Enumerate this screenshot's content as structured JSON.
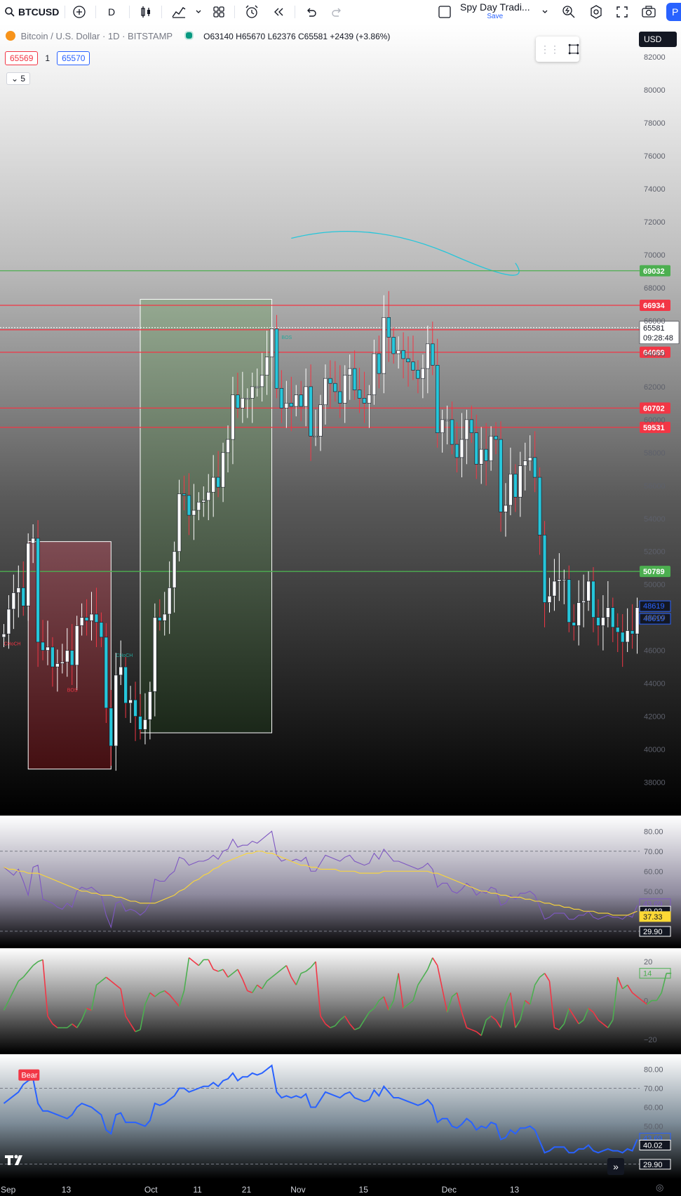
{
  "toolbar": {
    "symbol": "BTCUSD",
    "interval": "D",
    "layout_name": "Spy Day Tradi...",
    "save_label": "Save",
    "publish_label": "P"
  },
  "legend": {
    "title": "Bitcoin / U.S. Dollar · 1D · BITSTAMP",
    "open_label": "O",
    "open": "63140",
    "high_label": "H",
    "high": "65670",
    "low_label": "L",
    "low": "62376",
    "close_label": "C",
    "close": "65581",
    "change": "+2439 (+3.86%)",
    "bid": "65569",
    "spread": "1",
    "ask": "65570",
    "indicators_toggle": "5"
  },
  "currency": "USD",
  "colors": {
    "up": "#ffffff",
    "down": "#26c6da",
    "support_line": "#4caf50",
    "resistance_line": "#f23645",
    "rsi": "#7e57c2",
    "rsi_ma": "#fdd835",
    "macd_up": "#4caf50",
    "macd_down": "#f23645",
    "bottom_osc": "#2962ff",
    "arc": "#26c6da"
  },
  "icons": [
    "search-icon",
    "plus-circle-icon",
    "candles-icon",
    "indicators-icon",
    "chevron-down-icon",
    "layouts-icon",
    "alarm-icon",
    "replay-icon",
    "undo-icon",
    "redo-icon",
    "layout-box-icon",
    "lightning-icon",
    "settings-icon",
    "fullscreen-icon",
    "camera-icon",
    "drag-handle-icon",
    "rectangle-icon",
    "tradingview-logo-icon",
    "scroll-forward-icon",
    "gear-icon"
  ],
  "chart_data": [
    {
      "type": "candlestick",
      "name": "BTCUSD 1D",
      "ylim": [
        37000,
        83500
      ],
      "y_ticks": [
        38000,
        40000,
        42000,
        44000,
        46000,
        48000,
        50000,
        52000,
        54000,
        56000,
        58000,
        60000,
        62000,
        64000,
        66000,
        68000,
        70000,
        72000,
        74000,
        76000,
        78000,
        80000,
        82000
      ],
      "x_ticks": [
        "Sep",
        "13",
        "Oct",
        "11",
        "21",
        "Nov",
        "15",
        "Dec",
        "13"
      ],
      "closes": [
        47000,
        48500,
        49500,
        49800,
        48700,
        52500,
        52800,
        46500,
        46000,
        46200,
        45000,
        45200,
        45300,
        46000,
        45100,
        47500,
        48000,
        47800,
        48200,
        47700,
        46800,
        42500,
        40200,
        44500,
        45000,
        42800,
        43000,
        42000,
        41200,
        41800,
        43500,
        48000,
        47800,
        48200,
        49800,
        52000,
        55500,
        55400,
        54200,
        54500,
        55000,
        55100,
        55600,
        56500,
        55900,
        58000,
        58800,
        61500,
        60700,
        61300,
        61300,
        62000,
        62000,
        62700,
        63800,
        65500,
        61900,
        60700,
        61000,
        60800,
        61500,
        60800,
        62000,
        59000,
        59000,
        60900,
        62500,
        62200,
        61700,
        61000,
        62700,
        63100,
        61800,
        61300,
        61000,
        61500,
        64000,
        62800,
        66200,
        65000,
        64000,
        64200,
        63700,
        63500,
        63000,
        62500,
        63100,
        64600,
        63300,
        59200,
        60000,
        60000,
        58500,
        57700,
        58800,
        60000,
        59200,
        57300,
        58200,
        57500,
        59000,
        58800,
        54400,
        54800,
        56700,
        55300,
        57200,
        57500,
        57700,
        56500,
        53000,
        48900,
        49300,
        50200,
        50300,
        50300,
        47700,
        47500,
        48900,
        49000,
        50200,
        48000,
        47500,
        48000,
        48600,
        47400,
        47100,
        46500,
        47200,
        47000,
        48600
      ],
      "opens": [
        46800,
        47000,
        48500,
        49500,
        49800,
        48700,
        52500,
        52800,
        46500,
        46000,
        46200,
        45000,
        45200,
        45300,
        46000,
        45100,
        47500,
        48000,
        47800,
        48200,
        47700,
        46800,
        42500,
        40200,
        44500,
        45000,
        42800,
        43000,
        42000,
        41200,
        41800,
        43500,
        48000,
        47800,
        48200,
        49800,
        52000,
        55500,
        55400,
        54200,
        54500,
        55000,
        55100,
        55600,
        56500,
        55900,
        58000,
        58800,
        61500,
        60700,
        61300,
        61300,
        62000,
        62000,
        62700,
        63800,
        65500,
        61900,
        60700,
        61000,
        60800,
        61500,
        60800,
        62000,
        59000,
        59000,
        60900,
        62500,
        62200,
        61700,
        61000,
        62700,
        63100,
        61800,
        61300,
        61000,
        61500,
        64000,
        62800,
        66200,
        65000,
        64000,
        64200,
        63700,
        63500,
        63000,
        62500,
        63100,
        64600,
        63300,
        59200,
        60000,
        60000,
        58500,
        57700,
        58800,
        60000,
        59200,
        57300,
        58200,
        57500,
        59000,
        58800,
        54400,
        54800,
        56700,
        55300,
        57200,
        57500,
        57700,
        56500,
        53000,
        48900,
        49300,
        50200,
        50300,
        50300,
        47700,
        47500,
        48900,
        49000,
        50200,
        48000,
        47500,
        48000,
        48600,
        47400,
        47100,
        46500,
        47200,
        47000
      ],
      "horizontal_levels": [
        {
          "price": 69032,
          "label": "69032",
          "color": "#4caf50"
        },
        {
          "price": 66934,
          "label": "66934",
          "color": "#f23645"
        },
        {
          "price": 65453,
          "label": "65453",
          "color": "#f23645"
        },
        {
          "price": 64089,
          "label": "64089",
          "color": "#f23645"
        },
        {
          "price": 60702,
          "label": "60702",
          "color": "#f23645"
        },
        {
          "price": 59531,
          "label": "59531",
          "color": "#f23645"
        },
        {
          "price": 50789,
          "label": "50789",
          "color": "#4caf50"
        }
      ],
      "last_price": {
        "price": 65581,
        "label": "65581",
        "countdown": "09:28:48"
      },
      "blue_badges": [
        "48619",
        "48619"
      ],
      "annotations": [
        "CHoCH",
        "BOS",
        "CHoCH",
        "BOS"
      ]
    },
    {
      "type": "line",
      "name": "RSI",
      "ylim": [
        25,
        85
      ],
      "y_ticks": [
        80.0,
        70.0,
        60.0,
        50.0,
        40.0,
        30.0
      ],
      "y_tick_labels": [
        "80.00",
        "70.00",
        "60.00",
        "50.00",
        "40.00",
        "30.00"
      ],
      "bands": [
        70,
        30
      ],
      "badges": [
        "43.69",
        "40.02",
        "37.33",
        "29.90"
      ],
      "series": [
        {
          "values": [
            62,
            60,
            58,
            61,
            55,
            48,
            62,
            63,
            46,
            45,
            44,
            42,
            41,
            44,
            42,
            50,
            52,
            51,
            52,
            50,
            48,
            38,
            32,
            44,
            45,
            40,
            41,
            40,
            38,
            40,
            44,
            56,
            55,
            55,
            58,
            60,
            67,
            66,
            63,
            64,
            65,
            65,
            66,
            68,
            66,
            70,
            71,
            76,
            72,
            73,
            73,
            75,
            74,
            76,
            78,
            80,
            68,
            65,
            66,
            65,
            66,
            65,
            67,
            60,
            60,
            64,
            68,
            67,
            66,
            65,
            67,
            68,
            65,
            64,
            63,
            64,
            69,
            66,
            71,
            68,
            65,
            65,
            64,
            63,
            62,
            61,
            62,
            64,
            61,
            52,
            54,
            54,
            50,
            49,
            51,
            54,
            52,
            48,
            50,
            49,
            52,
            51,
            43,
            44,
            48,
            46,
            49,
            49,
            50,
            48,
            42,
            36,
            37,
            39,
            39,
            39,
            36,
            36,
            38,
            38,
            40,
            37,
            36,
            37,
            38,
            37,
            37,
            36,
            38,
            37,
            43
          ]
        },
        {
          "values": [
            62,
            61,
            61,
            60,
            60,
            59,
            59,
            59,
            58,
            57,
            56,
            55,
            54,
            53,
            52,
            51,
            50,
            50,
            49,
            49,
            48,
            48,
            48,
            47,
            47,
            46,
            45,
            45,
            44,
            44,
            44,
            44,
            45,
            46,
            47,
            48,
            50,
            51,
            53,
            55,
            56,
            58,
            59,
            61,
            62,
            64,
            65,
            66,
            67,
            68,
            69,
            69,
            70,
            70,
            69,
            69,
            68,
            67,
            66,
            65,
            64,
            63,
            63,
            62,
            62,
            61,
            61,
            61,
            61,
            60,
            60,
            60,
            60,
            59,
            59,
            59,
            59,
            59,
            60,
            60,
            60,
            60,
            60,
            60,
            60,
            60,
            60,
            60,
            59,
            59,
            58,
            57,
            56,
            55,
            54,
            53,
            52,
            51,
            50,
            50,
            49,
            49,
            48,
            48,
            47,
            47,
            47,
            46,
            46,
            45,
            45,
            44,
            44,
            43,
            43,
            42,
            42,
            41,
            41,
            40,
            40,
            40,
            39,
            39,
            39,
            38,
            38,
            38,
            38,
            39,
            40
          ]
        }
      ]
    },
    {
      "type": "line",
      "name": "Momentum",
      "ylim": [
        -24,
        24
      ],
      "y_ticks": [
        20,
        0,
        -20
      ],
      "y_tick_labels": [
        "20",
        "0",
        "−20"
      ],
      "badges": [
        "14"
      ],
      "series": [
        {
          "values": [
            -5,
            0,
            5,
            10,
            12,
            15,
            18,
            20,
            21,
            -8,
            -12,
            -14,
            -14,
            -14,
            -12,
            -14,
            -10,
            -4,
            -5,
            8,
            10,
            12,
            10,
            8,
            6,
            -8,
            -12,
            -16,
            -15,
            -2,
            4,
            2,
            4,
            5,
            3,
            0,
            -3,
            5,
            22,
            20,
            18,
            21,
            21,
            16,
            15,
            16,
            12,
            14,
            16,
            11,
            5,
            4,
            8,
            6,
            10,
            12,
            14,
            16,
            18,
            12,
            8,
            14,
            15,
            17,
            20,
            -8,
            -12,
            -14,
            -13,
            -10,
            -8,
            -12,
            -15,
            -14,
            -10,
            -6,
            -4,
            0,
            2,
            -5,
            0,
            14,
            -4,
            -2,
            0,
            8,
            12,
            16,
            22,
            18,
            6,
            -6,
            2,
            4,
            -6,
            -14,
            -15,
            -16,
            -18,
            -10,
            -8,
            -10,
            -14,
            -2,
            4,
            -14,
            -10,
            0,
            -2,
            8,
            12,
            14,
            10,
            -14,
            -15,
            -12,
            -4,
            -8,
            -12,
            -10,
            -4,
            -6,
            -10,
            -12,
            -14,
            -10,
            12,
            6,
            8,
            4,
            2,
            0,
            -2,
            0,
            0,
            4,
            14,
            14
          ]
        }
      ]
    },
    {
      "type": "line",
      "name": "RSI Divergence",
      "ylim": [
        25,
        85
      ],
      "y_ticks": [
        80.0,
        70.0,
        60.0,
        50.0,
        40.0,
        30.0
      ],
      "y_tick_labels": [
        "80.00",
        "70.00",
        "60.00",
        "50.00",
        "40.00",
        "30.00"
      ],
      "bands": [
        70,
        30
      ],
      "badges": [
        "43.69",
        "40.02",
        "40.02",
        "29.90"
      ],
      "label": "Bear",
      "series": [
        {
          "values": [
            62,
            64,
            66,
            68,
            72,
            74,
            75,
            62,
            58,
            58,
            57,
            56,
            55,
            54,
            56,
            60,
            62,
            61,
            60,
            58,
            56,
            48,
            46,
            56,
            57,
            52,
            52,
            52,
            51,
            50,
            53,
            62,
            61,
            62,
            64,
            66,
            70,
            70,
            68,
            69,
            70,
            71,
            71,
            73,
            71,
            74,
            75,
            78,
            74,
            76,
            76,
            78,
            77,
            78,
            80,
            82,
            68,
            65,
            66,
            65,
            66,
            65,
            67,
            60,
            60,
            64,
            68,
            67,
            66,
            65,
            67,
            68,
            65,
            64,
            63,
            64,
            69,
            66,
            71,
            68,
            65,
            65,
            64,
            63,
            62,
            61,
            62,
            64,
            61,
            52,
            54,
            54,
            50,
            49,
            51,
            54,
            52,
            48,
            50,
            49,
            52,
            51,
            43,
            44,
            48,
            46,
            49,
            49,
            50,
            48,
            42,
            36,
            37,
            39,
            39,
            39,
            36,
            36,
            38,
            38,
            40,
            37,
            36,
            37,
            38,
            37,
            37,
            36,
            38,
            37,
            43
          ]
        }
      ]
    }
  ],
  "x_labels": [
    "Sep",
    "13",
    "Oct",
    "11",
    "21",
    "Nov",
    "15",
    "Dec",
    "13"
  ]
}
